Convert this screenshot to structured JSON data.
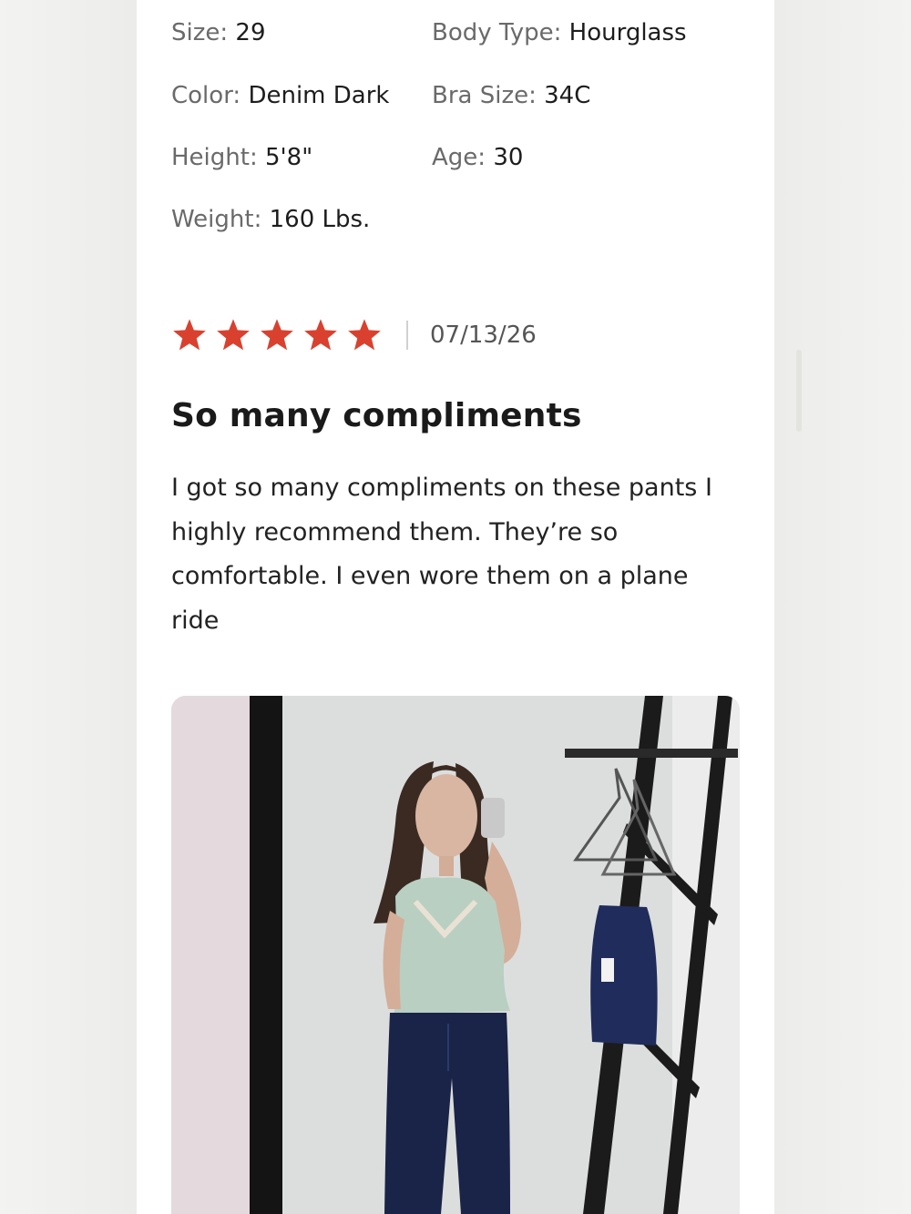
{
  "specs": {
    "size": {
      "label": "Size:",
      "value": "29"
    },
    "body_type": {
      "label": "Body Type:",
      "value": "Hourglass"
    },
    "color": {
      "label": "Color:",
      "value": "Denim Dark"
    },
    "bra_size": {
      "label": "Bra Size:",
      "value": "34C"
    },
    "height": {
      "label": "Height:",
      "value": "5'8\""
    },
    "age": {
      "label": "Age:",
      "value": "30"
    },
    "weight": {
      "label": "Weight:",
      "value": "160 Lbs."
    }
  },
  "review": {
    "rating": 5,
    "rating_max": 5,
    "star_color": "#d9412e",
    "date": "07/13/26",
    "title": "So many compliments",
    "body": "I got so many compliments on these pants I highly recommend them. They’re so comfortable. I even wore them on a plane ride"
  },
  "photo": {
    "icon": "review-photo"
  }
}
